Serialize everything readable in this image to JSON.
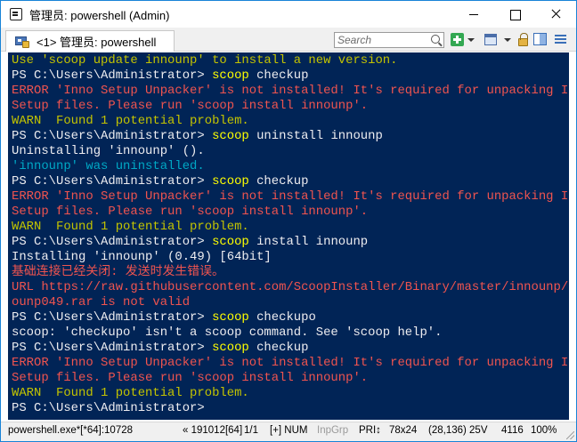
{
  "window": {
    "title": "管理员: powershell (Admin)",
    "accent": "#1883d7"
  },
  "tab": {
    "label": "<1>  管理员: powershell"
  },
  "search": {
    "placeholder": "Search"
  },
  "toolbar": {
    "icons": [
      "plus-icon",
      "window-icon",
      "lock-icon",
      "split-icon",
      "menu-icon"
    ]
  },
  "console": {
    "background": "#012456",
    "lines": [
      [
        {
          "t": "Use 'scoop update innounp' to install a new version.",
          "c": "warn"
        }
      ],
      [
        {
          "t": "PS C:\\Users\\Administrator> ",
          "c": "white"
        },
        {
          "t": "scoop",
          "c": "cmd"
        },
        {
          "t": " checkup",
          "c": "white"
        }
      ],
      [
        {
          "t": "ERROR 'Inno Setup Unpacker' is not installed! It's required for unpacking Inno",
          "c": "err"
        }
      ],
      [
        {
          "t": "Setup files. Please run 'scoop install innounp'.",
          "c": "err"
        }
      ],
      [
        {
          "t": "WARN  Found 1 potential problem.",
          "c": "warn"
        }
      ],
      [
        {
          "t": "PS C:\\Users\\Administrator> ",
          "c": "white"
        },
        {
          "t": "scoop",
          "c": "cmd"
        },
        {
          "t": " uninstall innounp",
          "c": "white"
        }
      ],
      [
        {
          "t": "Uninstalling 'innounp' ().",
          "c": "white"
        }
      ],
      [
        {
          "t": "'innounp' was uninstalled.",
          "c": "cyan"
        }
      ],
      [
        {
          "t": "PS C:\\Users\\Administrator> ",
          "c": "white"
        },
        {
          "t": "scoop",
          "c": "cmd"
        },
        {
          "t": " checkup",
          "c": "white"
        }
      ],
      [
        {
          "t": "ERROR 'Inno Setup Unpacker' is not installed! It's required for unpacking Inno",
          "c": "err"
        }
      ],
      [
        {
          "t": "Setup files. Please run 'scoop install innounp'.",
          "c": "err"
        }
      ],
      [
        {
          "t": "WARN  Found 1 potential problem.",
          "c": "warn"
        }
      ],
      [
        {
          "t": "PS C:\\Users\\Administrator> ",
          "c": "white"
        },
        {
          "t": "scoop",
          "c": "cmd"
        },
        {
          "t": " install innounp",
          "c": "white"
        }
      ],
      [
        {
          "t": "Installing 'innounp' (0.49) [64bit]",
          "c": "white"
        }
      ],
      [
        {
          "t": "基础连接已经关闭: 发送时发生错误。",
          "c": "err"
        }
      ],
      [
        {
          "t": "URL https://raw.githubusercontent.com/ScoopInstaller/Binary/master/innounp/inn",
          "c": "err"
        }
      ],
      [
        {
          "t": "ounp049.rar is not valid",
          "c": "err"
        }
      ],
      [
        {
          "t": "PS C:\\Users\\Administrator> ",
          "c": "white"
        },
        {
          "t": "scoop",
          "c": "cmd"
        },
        {
          "t": " checkupo",
          "c": "white"
        }
      ],
      [
        {
          "t": "scoop: 'checkupo' isn't a scoop command. See 'scoop help'.",
          "c": "white"
        }
      ],
      [
        {
          "t": "PS C:\\Users\\Administrator> ",
          "c": "white"
        },
        {
          "t": "scoop",
          "c": "cmd"
        },
        {
          "t": " checkup",
          "c": "white"
        }
      ],
      [
        {
          "t": "ERROR 'Inno Setup Unpacker' is not installed! It's required for unpacking Inno",
          "c": "err"
        }
      ],
      [
        {
          "t": "Setup files. Please run 'scoop install innounp'.",
          "c": "err"
        }
      ],
      [
        {
          "t": "WARN  Found 1 potential problem.",
          "c": "warn"
        }
      ],
      [
        {
          "t": "PS C:\\Users\\Administrator> ",
          "c": "white"
        }
      ]
    ]
  },
  "status": {
    "process": "powershell.exe*[*64]:10728",
    "build": "« 191012[64]",
    "pos": "1/1",
    "flags": "[+] NUM",
    "inpgrp": "InpGrp",
    "pri": "PRI↕",
    "size": "78x24",
    "cursor": "(28,136) 25V",
    "pid": "4116",
    "zoom": "100%"
  }
}
